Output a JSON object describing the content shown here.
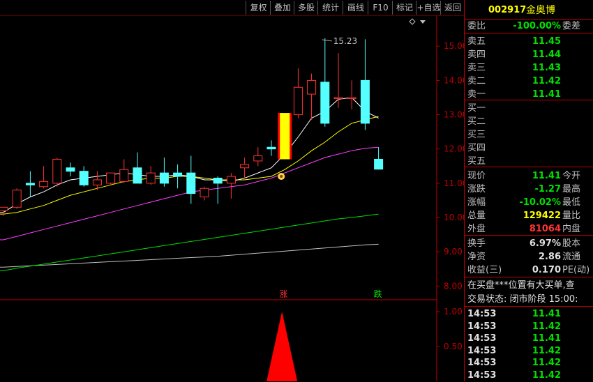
{
  "toolbar": {
    "buttons": [
      "复权",
      "叠加",
      "多股",
      "统计",
      "画线",
      "F10",
      "标记",
      "+自选",
      "返回"
    ]
  },
  "chart": {
    "price_axis": [
      "15.00",
      "14.00",
      "13.00",
      "12.00",
      "11.00",
      "10.00",
      "9.00",
      "8.00"
    ],
    "indicator_axis": [
      "1.00",
      "0.50"
    ],
    "high_label": "15.23",
    "rise_marker": "涨",
    "fall_marker": "跌",
    "colors": {
      "up": "#ff3333",
      "down": "#54ffff",
      "ma5": "#ffffff",
      "ma10": "#ffff00",
      "ma20": "#ff40ff",
      "ma60": "#00e000",
      "ma120": "#c0c0c0",
      "signal": "#ff0000",
      "bg": "#000000",
      "border": "#c00000"
    }
  },
  "chart_data": {
    "type": "candlestick",
    "y_range": [
      7.6,
      15.9
    ],
    "candles": [
      {
        "o": 10.2,
        "h": 10.3,
        "l": 10.05,
        "c": 10.3
      },
      {
        "o": 10.3,
        "h": 10.85,
        "l": 10.25,
        "c": 10.8
      },
      {
        "o": 11.0,
        "h": 11.35,
        "l": 10.6,
        "c": 10.95
      },
      {
        "o": 10.9,
        "h": 11.5,
        "l": 10.85,
        "c": 11.05
      },
      {
        "o": 11.0,
        "h": 11.75,
        "l": 10.9,
        "c": 11.7
      },
      {
        "o": 11.45,
        "h": 11.6,
        "l": 11.2,
        "c": 11.35
      },
      {
        "o": 11.35,
        "h": 11.5,
        "l": 10.9,
        "c": 10.95
      },
      {
        "o": 10.95,
        "h": 11.35,
        "l": 10.8,
        "c": 11.1
      },
      {
        "o": 11.0,
        "h": 11.3,
        "l": 10.95,
        "c": 11.3
      },
      {
        "o": 11.05,
        "h": 11.7,
        "l": 11.0,
        "c": 11.4
      },
      {
        "o": 11.45,
        "h": 11.9,
        "l": 11.0,
        "c": 11.0
      },
      {
        "o": 11.0,
        "h": 11.5,
        "l": 10.95,
        "c": 11.3
      },
      {
        "o": 11.3,
        "h": 11.75,
        "l": 10.9,
        "c": 11.0
      },
      {
        "o": 11.3,
        "h": 11.55,
        "l": 10.85,
        "c": 11.2
      },
      {
        "o": 11.3,
        "h": 11.8,
        "l": 10.4,
        "c": 10.7
      },
      {
        "o": 10.6,
        "h": 10.9,
        "l": 10.5,
        "c": 10.85
      },
      {
        "o": 11.15,
        "h": 11.2,
        "l": 10.4,
        "c": 11.0
      },
      {
        "o": 11.0,
        "h": 11.3,
        "l": 10.55,
        "c": 11.2
      },
      {
        "o": 11.45,
        "h": 11.75,
        "l": 11.15,
        "c": 11.55
      },
      {
        "o": 11.65,
        "h": 12.05,
        "l": 11.5,
        "c": 11.8
      },
      {
        "o": 12.05,
        "h": 12.25,
        "l": 11.8,
        "c": 12.0
      },
      {
        "o": 11.7,
        "h": 13.05,
        "l": 11.7,
        "c": 13.05
      },
      {
        "o": 13.0,
        "h": 14.35,
        "l": 12.9,
        "c": 13.8
      },
      {
        "o": 13.6,
        "h": 14.2,
        "l": 12.85,
        "c": 14.0
      },
      {
        "o": 13.95,
        "h": 15.23,
        "l": 12.65,
        "c": 12.75
      },
      {
        "o": 13.5,
        "h": 14.8,
        "l": 13.2,
        "c": 13.5
      },
      {
        "o": 13.5,
        "h": 14.0,
        "l": 13.15,
        "c": 13.5
      },
      {
        "o": 14.0,
        "h": 15.2,
        "l": 12.55,
        "c": 12.75
      },
      {
        "o": 11.7,
        "h": 12.05,
        "l": 11.41,
        "c": 11.41
      }
    ],
    "ma5": [
      10.15,
      10.4,
      10.6,
      10.75,
      10.95,
      11.1,
      11.15,
      11.2,
      11.25,
      11.3,
      11.25,
      11.2,
      11.2,
      11.25,
      11.2,
      11.1,
      11.1,
      11.05,
      11.15,
      11.3,
      11.45,
      11.85,
      12.35,
      12.9,
      13.1,
      13.45,
      13.5,
      13.1,
      12.9
    ],
    "ma10": [
      10.1,
      10.15,
      10.25,
      10.35,
      10.5,
      10.65,
      10.75,
      10.85,
      10.95,
      11.05,
      11.1,
      11.15,
      11.15,
      11.2,
      11.2,
      11.15,
      11.1,
      11.1,
      11.1,
      11.15,
      11.2,
      11.4,
      11.65,
      11.95,
      12.2,
      12.5,
      12.75,
      12.85,
      12.95
    ],
    "ma20": [
      9.35,
      9.45,
      9.55,
      9.65,
      9.75,
      9.85,
      9.95,
      10.05,
      10.15,
      10.25,
      10.35,
      10.45,
      10.55,
      10.65,
      10.75,
      10.8,
      10.85,
      10.9,
      10.95,
      11.05,
      11.15,
      11.3,
      11.45,
      11.6,
      11.75,
      11.85,
      11.95,
      12.02,
      12.05
    ],
    "ma60": [
      8.45,
      8.52,
      8.58,
      8.64,
      8.7,
      8.76,
      8.82,
      8.88,
      8.94,
      9.0,
      9.06,
      9.12,
      9.18,
      9.24,
      9.3,
      9.36,
      9.42,
      9.48,
      9.54,
      9.6,
      9.66,
      9.72,
      9.78,
      9.84,
      9.9,
      9.96,
      10.0,
      10.05,
      10.1
    ],
    "ma120": [
      8.55,
      8.57,
      8.59,
      8.61,
      8.63,
      8.65,
      8.67,
      8.69,
      8.71,
      8.73,
      8.75,
      8.77,
      8.79,
      8.81,
      8.83,
      8.85,
      8.87,
      8.9,
      8.93,
      8.96,
      8.99,
      9.02,
      9.05,
      9.08,
      9.11,
      9.14,
      9.17,
      9.2,
      9.22
    ],
    "indicator": {
      "type": "triangle",
      "index": 21,
      "value": 1.0,
      "y_range": [
        0,
        1.15
      ]
    }
  },
  "quote": {
    "code": "002917",
    "name": "金奥博",
    "weibi_label": "委比",
    "weibi_value": "-100.00%",
    "weicha_label": "委差",
    "sells": [
      {
        "label": "卖五",
        "price": "11.45"
      },
      {
        "label": "卖四",
        "price": "11.44"
      },
      {
        "label": "卖三",
        "price": "11.43"
      },
      {
        "label": "卖二",
        "price": "11.42"
      },
      {
        "label": "卖一",
        "price": "11.41"
      }
    ],
    "buys": [
      {
        "label": "买一",
        "price": ""
      },
      {
        "label": "买二",
        "price": ""
      },
      {
        "label": "买三",
        "price": ""
      },
      {
        "label": "买四",
        "price": ""
      },
      {
        "label": "买五",
        "price": ""
      }
    ],
    "stats": [
      {
        "l1": "现价",
        "v": "11.41",
        "l2": "今开",
        "color": "green"
      },
      {
        "l1": "涨跌",
        "v": "-1.27",
        "l2": "最高",
        "color": "green"
      },
      {
        "l1": "涨幅",
        "v": "-10.02%",
        "l2": "最低",
        "color": "green"
      },
      {
        "l1": "总量",
        "v": "129422",
        "l2": "量比",
        "color": "yellow"
      },
      {
        "l1": "外盘",
        "v": "81064",
        "l2": "内盘",
        "color": "red"
      }
    ],
    "stats2": [
      {
        "l1": "换手",
        "v": "6.97%",
        "l2": "股本",
        "color": "white"
      },
      {
        "l1": "净资",
        "v": "2.86",
        "l2": "流通",
        "color": "white"
      },
      {
        "l1": "收益(三)",
        "v": "0.170",
        "l2": "PE(动)",
        "color": "white"
      }
    ],
    "notice": "在买盘***位置有大买单,查",
    "status": "交易状态: 闭市阶段 15:00:",
    "ticks": [
      {
        "time": "14:53",
        "price": "11.41"
      },
      {
        "time": "14:53",
        "price": "11.42"
      },
      {
        "time": "14:53",
        "price": "11.41"
      },
      {
        "time": "14:53",
        "price": "11.42"
      },
      {
        "time": "14:53",
        "price": "11.42"
      },
      {
        "time": "14:53",
        "price": "11.42"
      }
    ]
  }
}
